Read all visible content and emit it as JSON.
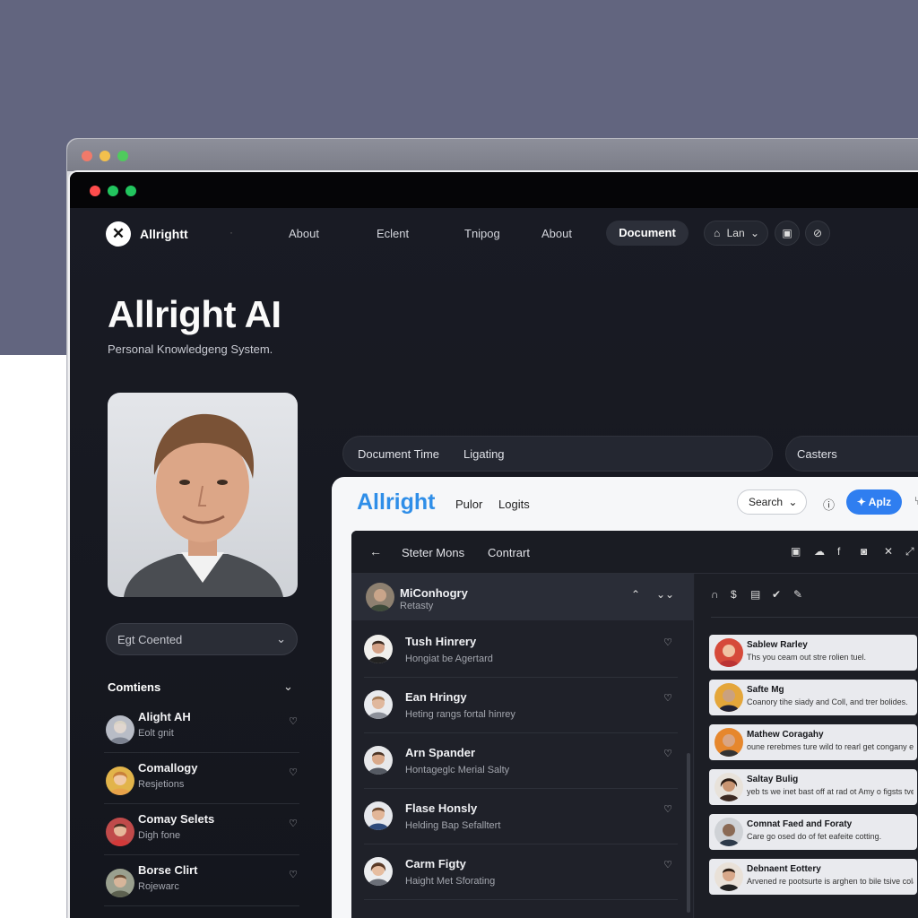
{
  "nav": {
    "logo": "✕",
    "brand": "Allrightt",
    "separator": "·",
    "links": [
      "About",
      "Eclent",
      "Tnipog",
      "About"
    ],
    "active": "Document",
    "lang": "Lan",
    "lang_icon": "bell-icon"
  },
  "hero": {
    "title": "Allright AI",
    "subtitle": "Personal Knowledgeng System."
  },
  "sidebar": {
    "select_value": "Egt Coented",
    "section_title": "Comtiens",
    "contacts": [
      {
        "name": "Alight AH",
        "sub": "Eolt gnit"
      },
      {
        "name": "Comallogy",
        "sub": "Resjetions"
      },
      {
        "name": "Comay Selets",
        "sub": "Digh fone"
      },
      {
        "name": "Borse Clirt",
        "sub": "Rojewarc"
      }
    ]
  },
  "doc_bar": {
    "label1": "Document Time",
    "label2": "Ligating",
    "casters": "Casters"
  },
  "card": {
    "title": "Allright",
    "links": [
      "Pulor",
      "Logits"
    ],
    "search": "Search",
    "apply": "Aplz",
    "panel": {
      "title": "Steter Mons",
      "contact": "Contrart",
      "selected": {
        "name": "MiConhogry",
        "sub": "Retasty"
      },
      "rows": [
        {
          "name": "Tush Hinrery",
          "sub": "Hongiat be Agertard"
        },
        {
          "name": "Ean Hringy",
          "sub": "Heting rangs fortal hinrey"
        },
        {
          "name": "Arn Spander",
          "sub": "Hontageglc Merial Salty"
        },
        {
          "name": "Flase Honsly",
          "sub": "Helding Bap Sefalltert"
        },
        {
          "name": "Carm Figty",
          "sub": "Haight Met Sforating"
        }
      ],
      "messages": [
        {
          "name": "Sablew Rarley",
          "text": "Ths you ceam out stre rolien tuel."
        },
        {
          "name": "Safte Mg",
          "text": "Coanory tihe siady and Coll, and trer bolides."
        },
        {
          "name": "Mathew Coragahy",
          "text": "oune rerebmes ture wild to rearl get congany ed fit ture temartre."
        },
        {
          "name": "Saltay Bulig",
          "text": "yeb ts we inet bast off at rad ot Amy o figsts tvett m of cone cerre."
        },
        {
          "name": "Comnat Faed and Foraty",
          "text": "Care go osed do of fet eafeite cotting."
        },
        {
          "name": "Debnaent Eottery",
          "text": "Arvened re pootsurte is arghen to bile tsive colatre."
        }
      ]
    }
  },
  "colors": {
    "accent": "#2f8ee8",
    "apply": "#2f7ef0",
    "background": "#15171f"
  }
}
